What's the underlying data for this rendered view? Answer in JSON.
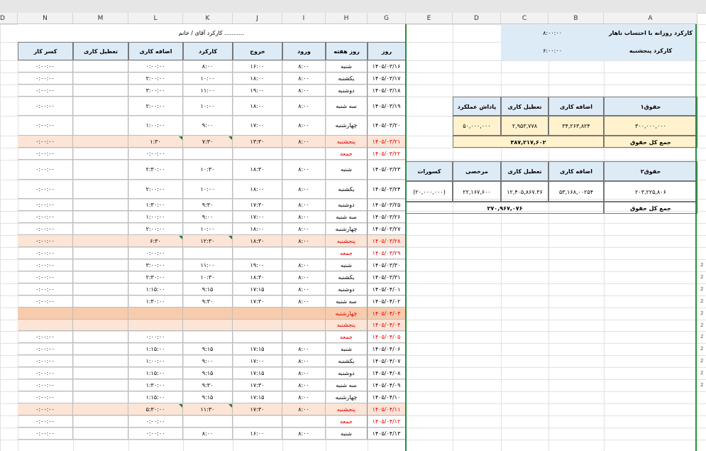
{
  "columns": [
    "D",
    "N",
    "M",
    "L",
    "K",
    "J",
    "I",
    "H",
    "G",
    "E",
    "D",
    "C",
    "B",
    "A"
  ],
  "left_title": "کارکرد آقای / خانم ...........",
  "left_headers": [
    "کسر کار",
    "تعطیل کاری",
    "اضافه کاری",
    "کارکرد",
    "خروج",
    "ورود",
    "روز هفته",
    "روز"
  ],
  "rows": [
    {
      "kasr": "۰:۰۰:۰۰",
      "tatil": "",
      "ezafe": "۰:۰۰:۰۰",
      "karkard": "۸:۰۰",
      "khorooj": "۱۶:۰۰",
      "vorood": "۸:۰۰",
      "day": "شنبه",
      "date": "۱۴۰۵/۰۳/۱۶",
      "red": false,
      "peach": false
    },
    {
      "kasr": "۰:۰۰:۰۰",
      "tatil": "",
      "ezafe": "۲:۰۰:۰۰",
      "karkard": "۱۰:۰۰",
      "khorooj": "۱۸:۰۰",
      "vorood": "۸:۰۰",
      "day": "یکشنبه",
      "date": "۱۴۰۵/۰۳/۱۷",
      "red": false,
      "peach": false
    },
    {
      "kasr": "۰:۰۰:۰۰",
      "tatil": "",
      "ezafe": "۳:۰۰:۰۰",
      "karkard": "۱۱:۰۰",
      "khorooj": "۱۹:۰۰",
      "vorood": "۸:۰۰",
      "day": "دوشنبه",
      "date": "۱۴۰۵/۰۳/۱۸",
      "red": false,
      "peach": false
    },
    {
      "kasr": "۰:۰۰:۰۰",
      "tatil": "",
      "ezafe": "۲:۰۰:۰۰",
      "karkard": "۱۰:۰۰",
      "khorooj": "۱۸:۰۰",
      "vorood": "۸:۰۰",
      "day": "سه شنبه",
      "date": "۱۴۰۵/۰۳/۱۹",
      "red": false,
      "peach": false
    },
    {
      "kasr": "۰:۰۰:۰۰",
      "tatil": "",
      "ezafe": "۱:۰۰:۰۰",
      "karkard": "۹:۰۰",
      "khorooj": "۱۷:۰۰",
      "vorood": "۸:۰۰",
      "day": "چهارشنبه",
      "date": "۱۴۰۵/۰۳/۲۰",
      "red": false,
      "peach": false
    },
    {
      "kasr": "۰:۰۰:۰۰",
      "tatil": "",
      "ezafe": "۱:۳۰",
      "karkard": "۷:۳۰",
      "khorooj": "۱۳:۳۰",
      "vorood": "۸:۰۰",
      "day": "پنجشنبه",
      "date": "۱۴۰۵/۰۳/۲۱",
      "red": true,
      "peach": true
    },
    {
      "kasr": "۰:۰۰:۰۰",
      "tatil": "",
      "ezafe": "۰:۰۰:۰۰",
      "karkard": "",
      "khorooj": "",
      "vorood": "",
      "day": "جمعه",
      "date": "۱۴۰۵/۰۳/۲۲",
      "red": true,
      "peach": false
    },
    {
      "kasr": "۰:۰۰:۰۰",
      "tatil": "",
      "ezafe": "۲:۳۰:۰۰",
      "karkard": "۱۰:۳۰",
      "khorooj": "۱۸:۳۰",
      "vorood": "۸:۰۰",
      "day": "شنبه",
      "date": "۱۴۰۵/۰۳/۲۳",
      "red": false,
      "peach": false
    },
    {
      "kasr": "۰:۰۰:۰۰",
      "tatil": "",
      "ezafe": "۲:۰۰:۰۰",
      "karkard": "۱۰:۰۰",
      "khorooj": "۱۸:۰۰",
      "vorood": "۸:۰۰",
      "day": "یکشنبه",
      "date": "۱۴۰۵/۰۳/۲۴",
      "red": false,
      "peach": false
    },
    {
      "kasr": "۰:۰۰:۰۰",
      "tatil": "",
      "ezafe": "۱:۳۰:۰۰",
      "karkard": "۹:۳۰",
      "khorooj": "۱۷:۳۰",
      "vorood": "۸:۰۰",
      "day": "دوشنبه",
      "date": "۱۴۰۵/۰۳/۲۵",
      "red": false,
      "peach": false
    },
    {
      "kasr": "۰:۰۰:۰۰",
      "tatil": "",
      "ezafe": "۱:۰۰:۰۰",
      "karkard": "۹:۰۰",
      "khorooj": "۱۷:۰۰",
      "vorood": "۸:۰۰",
      "day": "سه شنبه",
      "date": "۱۴۰۵/۰۳/۲۶",
      "red": false,
      "peach": false
    },
    {
      "kasr": "۰:۰۰:۰۰",
      "tatil": "",
      "ezafe": "۲:۰۰:۰۰",
      "karkard": "۱۰:۰۰",
      "khorooj": "۱۸:۰۰",
      "vorood": "۸:۰۰",
      "day": "چهارشنبه",
      "date": "۱۴۰۵/۰۳/۲۷",
      "red": false,
      "peach": false
    },
    {
      "kasr": "۰:۰۰:۰۰",
      "tatil": "",
      "ezafe": "۶:۳۰",
      "karkard": "۱۲:۳۰",
      "khorooj": "۱۸:۳۰",
      "vorood": "۸:۰۰",
      "day": "پنجشنبه",
      "date": "۱۴۰۵/۰۳/۲۸",
      "red": true,
      "peach": true
    },
    {
      "kasr": "۰:۰۰:۰۰",
      "tatil": "",
      "ezafe": "۰:۰۰:۰۰",
      "karkard": "",
      "khorooj": "",
      "vorood": "",
      "day": "جمعه",
      "date": "۱۴۰۵/۰۳/۲۹",
      "red": true,
      "peach": false
    },
    {
      "kasr": "۰:۰۰:۰۰",
      "tatil": "",
      "ezafe": "۳:۰۰:۰۰",
      "karkard": "۱۱:۰۰",
      "khorooj": "۱۹:۰۰",
      "vorood": "۸:۰۰",
      "day": "شنبه",
      "date": "۱۴۰۵/۰۳/۳۰",
      "red": false,
      "peach": false
    },
    {
      "kasr": "۰:۰۰:۰۰",
      "tatil": "",
      "ezafe": "۲:۳۰:۰۰",
      "karkard": "۱۰:۳۰",
      "khorooj": "۱۸:۳۰",
      "vorood": "۸:۰۰",
      "day": "یکشنبه",
      "date": "۱۴۰۵/۰۳/۳۱",
      "red": false,
      "peach": false
    },
    {
      "kasr": "۰:۰۰:۰۰",
      "tatil": "",
      "ezafe": "۱:۱۵:۰۰",
      "karkard": "۹:۱۵",
      "khorooj": "۱۷:۱۵",
      "vorood": "۸:۰۰",
      "day": "دوشنبه",
      "date": "۱۴۰۵/۰۴/۰۱",
      "red": false,
      "peach": false
    },
    {
      "kasr": "۰:۰۰:۰۰",
      "tatil": "",
      "ezafe": "۱:۳۰:۰۰",
      "karkard": "۹:۳۰",
      "khorooj": "۱۷:۳۰",
      "vorood": "۸:۰۰",
      "day": "سه شنبه",
      "date": "۱۴۰۵/۰۴/۰۲",
      "red": false,
      "peach": false
    },
    {
      "kasr": "",
      "tatil": "",
      "ezafe": "",
      "karkard": "",
      "khorooj": "",
      "vorood": "",
      "day": "چهارشنبه",
      "date": "۱۴۰۵/۰۴/۰۳",
      "red": true,
      "peach": true,
      "dark": true
    },
    {
      "kasr": "",
      "tatil": "",
      "ezafe": "",
      "karkard": "",
      "khorooj": "",
      "vorood": "",
      "day": "پنجشنبه",
      "date": "۱۴۰۵/۰۴/۰۴",
      "red": true,
      "peach": true
    },
    {
      "kasr": "۰:۰۰:۰۰",
      "tatil": "",
      "ezafe": "۰:۰۰:۰۰",
      "karkard": "",
      "khorooj": "",
      "vorood": "",
      "day": "جمعه",
      "date": "۱۴۰۵/۰۴/۰۵",
      "red": true,
      "peach": false
    },
    {
      "kasr": "۰:۰۰:۰۰",
      "tatil": "",
      "ezafe": "۱:۱۵:۰۰",
      "karkard": "۹:۱۵",
      "khorooj": "۱۷:۱۵",
      "vorood": "۸:۰۰",
      "day": "شنبه",
      "date": "۱۴۰۵/۰۴/۰۶",
      "red": false,
      "peach": false
    },
    {
      "kasr": "۰:۰۰:۰۰",
      "tatil": "",
      "ezafe": "۱:۰۰:۰۰",
      "karkard": "۹:۰۰",
      "khorooj": "۱۷:۰۰",
      "vorood": "۸:۰۰",
      "day": "یکشنبه",
      "date": "۱۴۰۵/۰۴/۰۷",
      "red": false,
      "peach": false
    },
    {
      "kasr": "۰:۰۰:۰۰",
      "tatil": "",
      "ezafe": "۱:۱۵:۰۰",
      "karkard": "۹:۱۵",
      "khorooj": "۱۷:۱۵",
      "vorood": "۸:۰۰",
      "day": "دوشنبه",
      "date": "۱۴۰۵/۰۴/۰۸",
      "red": false,
      "peach": false
    },
    {
      "kasr": "۰:۰۰:۰۰",
      "tatil": "",
      "ezafe": "۱:۳۰:۰۰",
      "karkard": "۹:۳۰",
      "khorooj": "۱۷:۳۰",
      "vorood": "۸:۰۰",
      "day": "سه شنبه",
      "date": "۱۴۰۵/۰۴/۰۹",
      "red": false,
      "peach": false
    },
    {
      "kasr": "۰:۰۰:۰۰",
      "tatil": "",
      "ezafe": "۱:۱۵:۰۰",
      "karkard": "۹:۱۵",
      "khorooj": "۱۷:۱۵",
      "vorood": "۸:۰۰",
      "day": "چهارشنبه",
      "date": "۱۴۰۵/۰۴/۱۰",
      "red": false,
      "peach": false
    },
    {
      "kasr": "۰:۰۰:۰۰",
      "tatil": "",
      "ezafe": "۵:۳۰:۰۰",
      "karkard": "۱۱:۳۰",
      "khorooj": "۱۷:۳۰",
      "vorood": "۸:۰۰",
      "day": "پنجشنبه",
      "date": "۱۴۰۵/۰۴/۱۱",
      "red": true,
      "peach": true
    },
    {
      "kasr": "۰:۰۰:۰۰",
      "tatil": "",
      "ezafe": "۰:۰۰:۰۰",
      "karkard": "",
      "khorooj": "",
      "vorood": "",
      "day": "جمعه",
      "date": "۱۴۰۵/۰۴/۱۲",
      "red": true,
      "peach": false
    },
    {
      "kasr": "۰:۰۰:۰۰",
      "tatil": "",
      "ezafe": "۰:۰۰:۰۰",
      "karkard": "۸:۰۰",
      "khorooj": "۱۶:۰۰",
      "vorood": "۸:۰۰",
      "day": "شنبه",
      "date": "۱۴۰۵/۰۴/۱۳",
      "red": false,
      "peach": false
    }
  ],
  "right": {
    "daily_label": "کارکرد روزانه با احتساب ناهار",
    "daily_value": "۸:۰۰:۰۰",
    "thursday_label": "کارکرد پنجشنبه",
    "thursday_value": "۶:۰۰:۰۰",
    "salary1": {
      "label": "حقوق۱",
      "headers": [
        "اضافه کاری",
        "تعطیل کاری",
        "پاداش عملکرد"
      ],
      "base": "۳۰۰,۰۰۰,۰۰۰",
      "ezafe": "۳۴,۲۶۳,۸۲۴",
      "tatil": "۲,۹۵۳,۷۷۸",
      "padash": "۵۰,۰۰۰,۰۰۰",
      "total_label": "جمع کل حقوق",
      "total": "۳۸۷,۲۱۷,۶۰۲"
    },
    "salary2": {
      "label": "حقوق۲",
      "headers": [
        "اضافه کاری",
        "تعطیل کاری",
        "مرخصی",
        "کسورات"
      ],
      "base": "۲۰۳,۲۲۵,۸۰۶",
      "ezafe": "۵۳,۱۶۸,۰۰۲۵۴",
      "tatil": "۱۲,۴۰۵,۸۶۷.۳۶",
      "morakhasi": "۲۲,۱۶۷,۶۰۰",
      "kosoorat": "(۲۰,۰۰۰,۰۰۰)",
      "total_label": "جمع کل حقوق",
      "total": "۲۷۰,۹۶۷,۰۷۶"
    }
  },
  "row_numbers": [
    "2",
    "2",
    "2",
    "2",
    "2",
    "2",
    "2",
    "2",
    "2",
    "2",
    "2"
  ],
  "colors": {
    "peach": "#fce4d6",
    "peach_dark": "#f8cbad",
    "blue": "#ddebf7",
    "yellow": "#fff2cc",
    "red": "#e00000",
    "green": "#2b8a3e"
  }
}
